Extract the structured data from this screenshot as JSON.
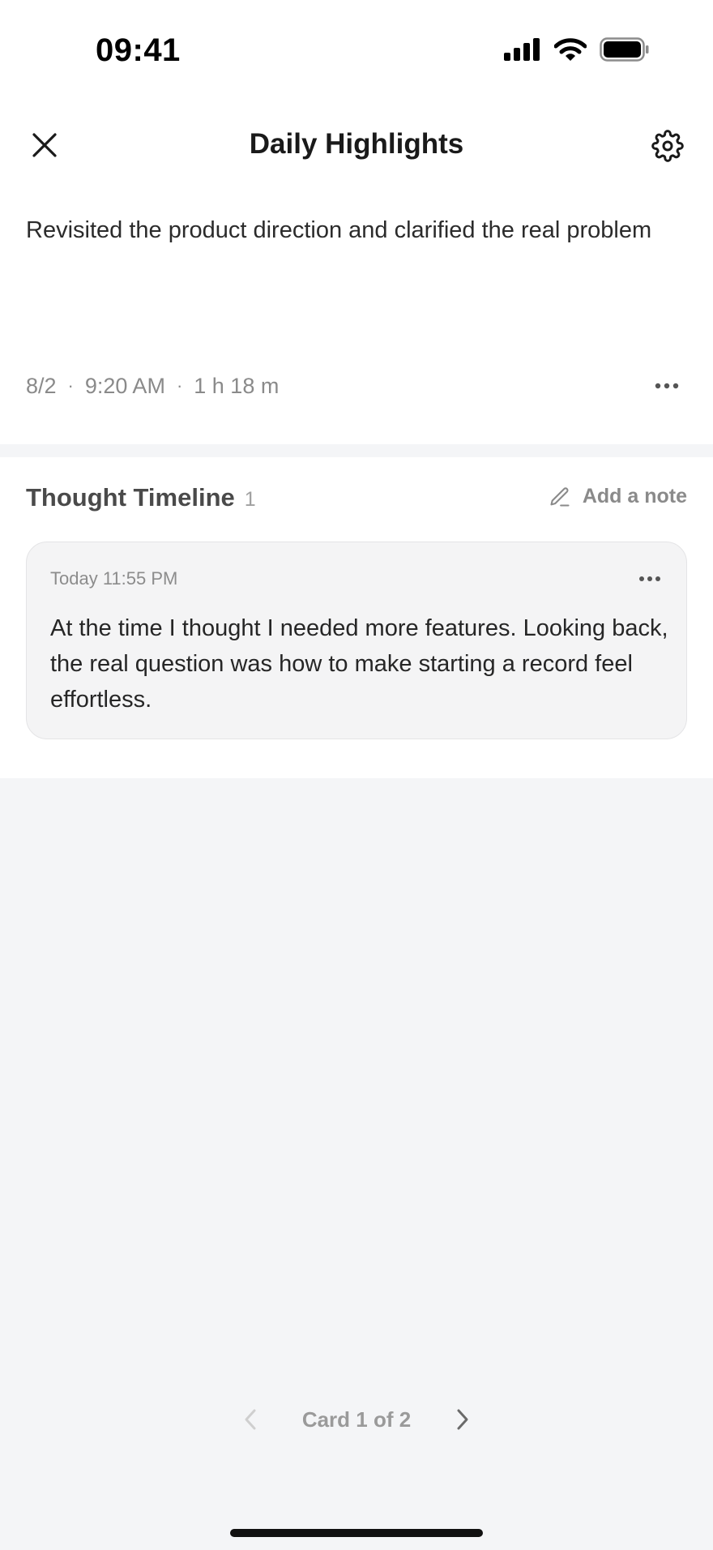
{
  "status_bar": {
    "time": "09:41",
    "icons": [
      "signal-icon",
      "wifi-icon",
      "battery-icon"
    ]
  },
  "nav": {
    "title": "Daily Highlights",
    "close_icon": "close-icon",
    "settings_icon": "gear-icon"
  },
  "highlight": {
    "text": "Revisited the product direction and clarified the real problem",
    "date": "8/2",
    "time": "9:20 AM",
    "duration": "1 h 18 m",
    "separator": "·"
  },
  "timeline": {
    "title": "Thought Timeline",
    "count": "1",
    "add_note_label": "Add a note",
    "notes": [
      {
        "timestamp": "Today 11:55 PM",
        "text": "At the time I thought I needed more features. Looking back, the real question was how to make starting a record feel effortless."
      }
    ]
  },
  "pager": {
    "label": "Card 1 of 2",
    "current": 1,
    "total": 2
  },
  "colors": {
    "background": "#f4f5f7",
    "surface": "#ffffff",
    "card": "#f4f4f5",
    "muted_text": "#8a8a8a"
  }
}
